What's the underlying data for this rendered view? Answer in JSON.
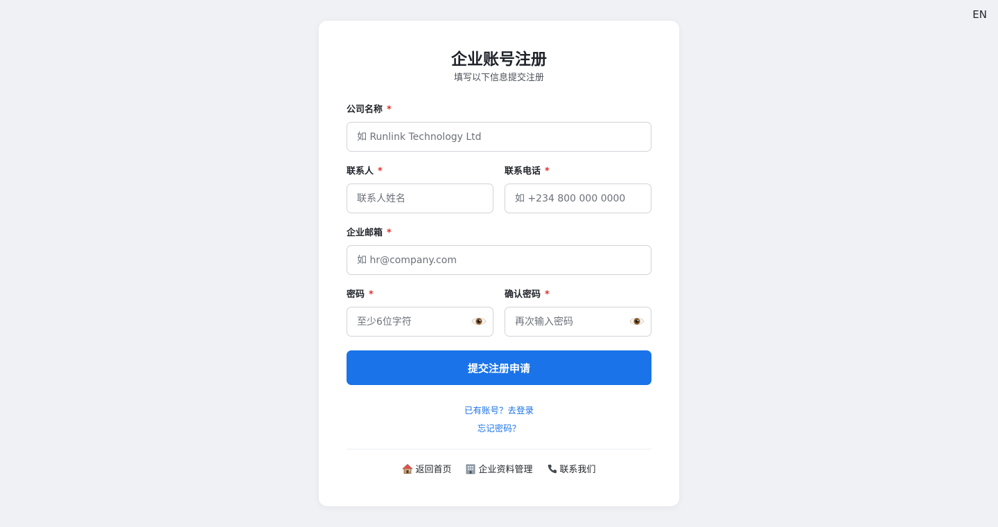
{
  "lang_toggle": "EN",
  "header": {
    "title": "企业账号注册",
    "subtitle": "填写以下信息提交注册"
  },
  "form": {
    "required_mark": "*",
    "company": {
      "label": "公司名称",
      "value": "",
      "placeholder": "如 Runlink Technology Ltd"
    },
    "contact": {
      "label": "联系人",
      "value": "",
      "placeholder": "联系人姓名"
    },
    "phone": {
      "label": "联系电话",
      "value": "",
      "placeholder": "如 +234 800 000 0000"
    },
    "email": {
      "label": "企业邮箱",
      "value": "",
      "placeholder": "如 hr@company.com"
    },
    "password": {
      "label": "密码",
      "value": "",
      "placeholder": "至少6位字符",
      "toggle_icon": "eye-icon"
    },
    "confirm_password": {
      "label": "确认密码",
      "value": "",
      "placeholder": "再次输入密码",
      "toggle_icon": "eye-icon"
    },
    "submit_label": "提交注册申请"
  },
  "links": {
    "login": "已有账号？去登录",
    "forgot": "忘记密码？"
  },
  "footer": {
    "items": [
      {
        "label": "返回首页",
        "icon": "house-icon"
      },
      {
        "label": "企业资料管理",
        "icon": "office-building-icon"
      },
      {
        "label": "联系我们",
        "icon": "phone-icon"
      }
    ]
  },
  "colors": {
    "primary": "#1a73e8",
    "required": "#e0302a",
    "background": "#f0f1f5"
  }
}
